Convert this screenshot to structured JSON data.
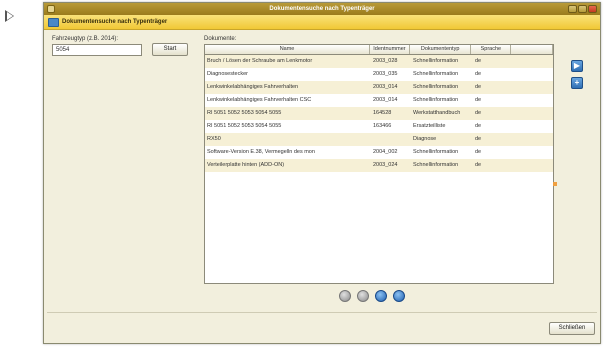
{
  "window": {
    "title": "Dokumentensuche nach Typenträger"
  },
  "subheader": {
    "title": "Dokumentensuche nach Typenträger"
  },
  "search": {
    "label": "Fahrzeugtyp (z.B. 2014):",
    "value": "5054",
    "start_label": "Start"
  },
  "documents": {
    "label": "Dokumente:",
    "columns": [
      "Name",
      "Identnummer",
      "Dokumententyp",
      "Sprache",
      ""
    ],
    "rows": [
      [
        "Bruch / Lösen der Schraube am Lenkmotor",
        "2003_028",
        "Schnellinformation",
        "de"
      ],
      [
        "Diagnosestecker",
        "2003_035",
        "Schnellinformation",
        "de"
      ],
      [
        "Lenkwinkelabhängiges Fahrverhalten",
        "2003_014",
        "Schnellinformation",
        "de"
      ],
      [
        "Lenkwinkelabhängiges Fahrverhalten CSC",
        "2003_014",
        "Schnellinformation",
        "de"
      ],
      [
        "RI 5051 5052 5053 5054 5055",
        "164528",
        "Werkstatthandbuch",
        "de"
      ],
      [
        "RI 5051 5052 5053 5054 5055",
        "163466",
        "Ersatzteilliste",
        "de"
      ],
      [
        "RX50",
        "",
        "Diagnose",
        "de"
      ],
      [
        "Software-Version E.38, Vermegelln des mon",
        "2004_002",
        "Schnellinformation",
        "de"
      ],
      [
        "Verteilerplatte hinten (ADD-ON)",
        "2003_024",
        "Schnellinformation",
        "de"
      ]
    ]
  },
  "footer": {
    "close_label": "Schließen"
  },
  "icons": {
    "side_top": "play-right-icon",
    "side_bottom": "plus-icon",
    "pager": "pagination-dot-icon"
  },
  "colors": {
    "title_bar": "#9a7b1c",
    "subheader": "#f1c836",
    "accent_blue": "#2f6fb4",
    "row_alt": "#f6f0d6"
  }
}
